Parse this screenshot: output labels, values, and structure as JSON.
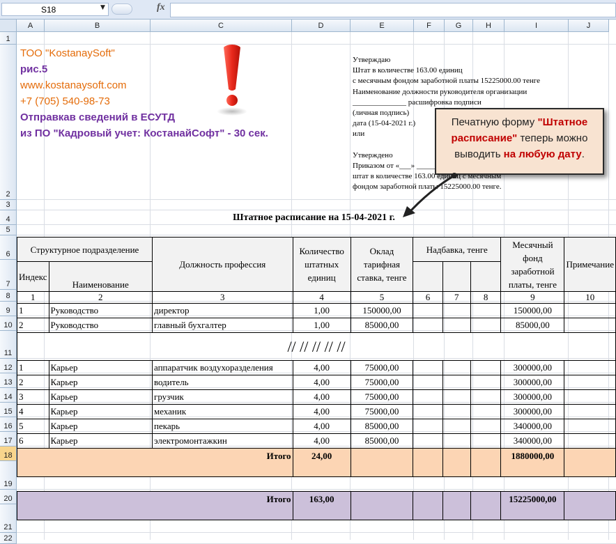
{
  "formula_bar": {
    "cell_ref": "S18",
    "fx_label": "fx",
    "formula": ""
  },
  "columns": [
    "A",
    "B",
    "C",
    "D",
    "E",
    "F",
    "G",
    "H",
    "I",
    "J"
  ],
  "rows": [
    "1",
    "2",
    "3",
    "4",
    "5",
    "6",
    "7",
    "8",
    "9",
    "10",
    "11",
    "12",
    "13",
    "14",
    "15",
    "16",
    "17",
    "18",
    "19",
    "20",
    "21",
    "22"
  ],
  "selected_row": "18",
  "company": {
    "name": "ТОО \"KostanaySoft\"",
    "fig": "рис.5",
    "site": "www.kostanaysoft.com",
    "phone": "+7 (705) 540-98-73",
    "line1": "Отправкав сведений в ЕСУТД",
    "line2": "из ПО  \"Кадровый учет: КостанайСофт\" - 30 сек."
  },
  "approval": [
    "Утверждаю",
    "Штат в количестве 163.00 единиц",
    "с месячным фондом заработной платы 15225000.00 тенге",
    "Наименование должности руководителя организации",
    "______________ расшифровка подписи",
    "(личная подпись)",
    "дата (15-04-2021 г.)",
    "или",
    "",
    "Утверждено",
    "Приказом от «___» ______________",
    "штат в количестве 163.00 единиц с месячным",
    "фондом заработной платы 15225000.00 тенге."
  ],
  "callout": {
    "part1": "Печатную форму ",
    "highlight1": "\"Штатное расписание\"",
    "part2": " теперь можно выводить ",
    "highlight2": "на любую дату",
    "part3": "."
  },
  "title": "Штатное расписание на 15-04-2021 г.",
  "headers": {
    "struct": "Структурное подразделение",
    "index": "Индекс",
    "name": "Наименование",
    "position": "Должность профессия",
    "qty": "Количество штатных единиц",
    "salary": "Оклад тарифная ставка, тенге",
    "bonus": "Надбавка, тенге",
    "fund": "Месячный фонд заработной платы, тенге",
    "note": "Примечание"
  },
  "col_numbers": [
    "1",
    "2",
    "3",
    "4",
    "5",
    "6",
    "7",
    "8",
    "9",
    "10"
  ],
  "rows_top": [
    {
      "idx": "1",
      "dept": "Руководство",
      "pos": "директор",
      "qty": "1,00",
      "salary": "150000,00",
      "fund": "150000,00"
    },
    {
      "idx": "2",
      "dept": "Руководство",
      "pos": "главный бухгалтер",
      "qty": "1,00",
      "salary": "85000,00",
      "fund": "85000,00"
    }
  ],
  "separator": "// // // // //",
  "rows_bottom": [
    {
      "idx": "1",
      "dept": "Карьер",
      "pos": "аппаратчик воздухоразделения",
      "qty": "4,00",
      "salary": "75000,00",
      "fund": "300000,00"
    },
    {
      "idx": "2",
      "dept": "Карьер",
      "pos": "водитель",
      "qty": "4,00",
      "salary": "75000,00",
      "fund": "300000,00"
    },
    {
      "idx": "3",
      "dept": "Карьер",
      "pos": "грузчик",
      "qty": "4,00",
      "salary": "75000,00",
      "fund": "300000,00"
    },
    {
      "idx": "4",
      "dept": "Карьер",
      "pos": "механик",
      "qty": "4,00",
      "salary": "75000,00",
      "fund": "300000,00"
    },
    {
      "idx": "5",
      "dept": "Карьер",
      "pos": "пекарь",
      "qty": "4,00",
      "salary": "85000,00",
      "fund": "340000,00"
    },
    {
      "idx": "6",
      "dept": "Карьер",
      "pos": "электромонтажкин",
      "qty": "4,00",
      "salary": "85000,00",
      "fund": "340000,00"
    }
  ],
  "total_dept": {
    "label": "Итого",
    "qty": "24,00",
    "fund": "1880000,00"
  },
  "total_all": {
    "label": "Итого",
    "qty": "163,00",
    "fund": "15225000,00"
  }
}
